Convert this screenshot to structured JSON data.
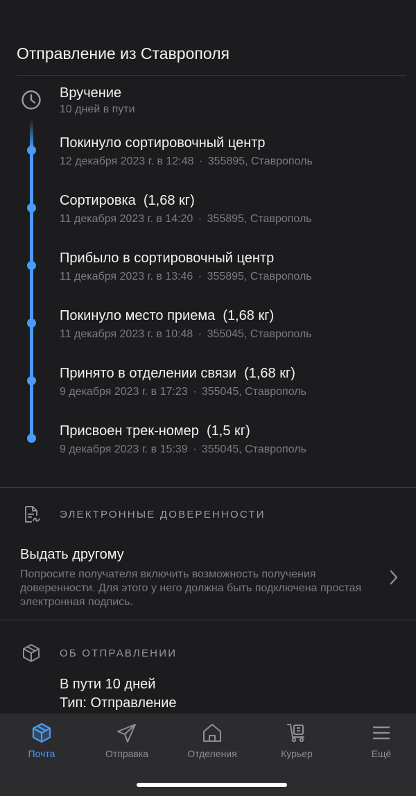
{
  "header": {
    "title": "Отправление из Ставрополя"
  },
  "tracking": {
    "delivery": {
      "title": "Вручение",
      "subtitle": "10 дней в пути"
    },
    "events": [
      {
        "title": "Покинуло сортировочный центр",
        "date": "12 декабря 2023 г. в 12:48",
        "place": "355895, Ставрополь"
      },
      {
        "title": "Сортировка  (1,68 кг)",
        "date": "11 декабря 2023 г. в 14:20",
        "place": "355895, Ставрополь"
      },
      {
        "title": "Прибыло в сортировочный центр",
        "date": "11 декабря 2023 г. в 13:46",
        "place": "355895, Ставрополь"
      },
      {
        "title": "Покинуло место приема  (1,68 кг)",
        "date": "11 декабря 2023 г. в 10:48",
        "place": "355045, Ставрополь"
      },
      {
        "title": "Принято в отделении связи  (1,68 кг)",
        "date": "9 декабря 2023 г. в 17:23",
        "place": "355045, Ставрополь"
      },
      {
        "title": "Присвоен трек-номер  (1,5 кг)",
        "date": "9 декабря 2023 г. в 15:39",
        "place": "355045, Ставрополь"
      }
    ],
    "separator": "·"
  },
  "proxy": {
    "heading": "ЭЛЕКТРОННЫЕ ДОВЕРЕННОСТИ",
    "title": "Выдать другому",
    "description": "Попросите получателя включить возможность получения доверенности. Для этого у него должна быть подключена простая электронная подпись."
  },
  "about": {
    "heading": "ОБ ОТПРАВЛЕНИИ",
    "in_transit": "В пути 10 дней",
    "type": "Тип: Отправление"
  },
  "tabbar": {
    "tabs": [
      {
        "label": "Почта",
        "icon": "package-icon",
        "active": true
      },
      {
        "label": "Отправка",
        "icon": "paper-plane-icon",
        "active": false
      },
      {
        "label": "Отделения",
        "icon": "house-icon",
        "active": false
      },
      {
        "label": "Курьер",
        "icon": "courier-cart-icon",
        "active": false
      },
      {
        "label": "Ещё",
        "icon": "menu-icon",
        "active": false
      }
    ]
  },
  "colors": {
    "accent": "#4a9bf7",
    "background": "#1c1c1e",
    "tabbar": "#2c2c2e",
    "secondary_text": "#7b7b80"
  }
}
